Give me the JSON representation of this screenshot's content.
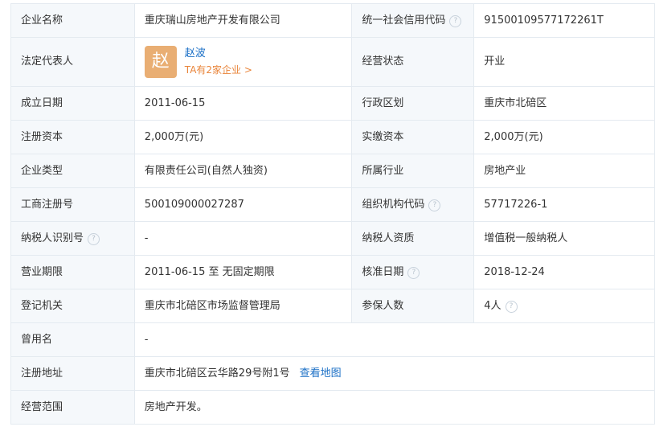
{
  "rows": {
    "r0": {
      "l1": "企业名称",
      "v1": "重庆瑞山房地产开发有限公司",
      "l2": "统一社会信用代码",
      "v2": "91500109577172261T"
    },
    "r1": {
      "l1": "法定代表人",
      "avatar_char": "赵",
      "person_name": "赵波",
      "person_link": "TA有2家企业 >",
      "l2": "经营状态",
      "v2": "开业"
    },
    "r2": {
      "l1": "成立日期",
      "v1": "2011-06-15",
      "l2": "行政区划",
      "v2": "重庆市北碚区"
    },
    "r3": {
      "l1": "注册资本",
      "v1": "2,000万(元)",
      "l2": "实缴资本",
      "v2": "2,000万(元)"
    },
    "r4": {
      "l1": "企业类型",
      "v1": "有限责任公司(自然人独资)",
      "l2": "所属行业",
      "v2": "房地产业"
    },
    "r5": {
      "l1": "工商注册号",
      "v1": "500109000027287",
      "l2": "组织机构代码",
      "v2": "57717226-1"
    },
    "r6": {
      "l1": "纳税人识别号",
      "v1": "-",
      "l2": "纳税人资质",
      "v2": "增值税一般纳税人"
    },
    "r7": {
      "l1": "营业期限",
      "v1": "2011-06-15 至 无固定期限",
      "l2": "核准日期",
      "v2": "2018-12-24"
    },
    "r8": {
      "l1": "登记机关",
      "v1": "重庆市北碚区市场监督管理局",
      "l2": "参保人数",
      "v2": "4人"
    },
    "r9": {
      "l1": "曾用名",
      "v1": "-"
    },
    "r10": {
      "l1": "注册地址",
      "v1": "重庆市北碚区云华路29号附1号",
      "map_link": "查看地图"
    },
    "r11": {
      "l1": "经营范围",
      "v1": "房地产开发。"
    }
  },
  "help_icon_glyph": "?"
}
